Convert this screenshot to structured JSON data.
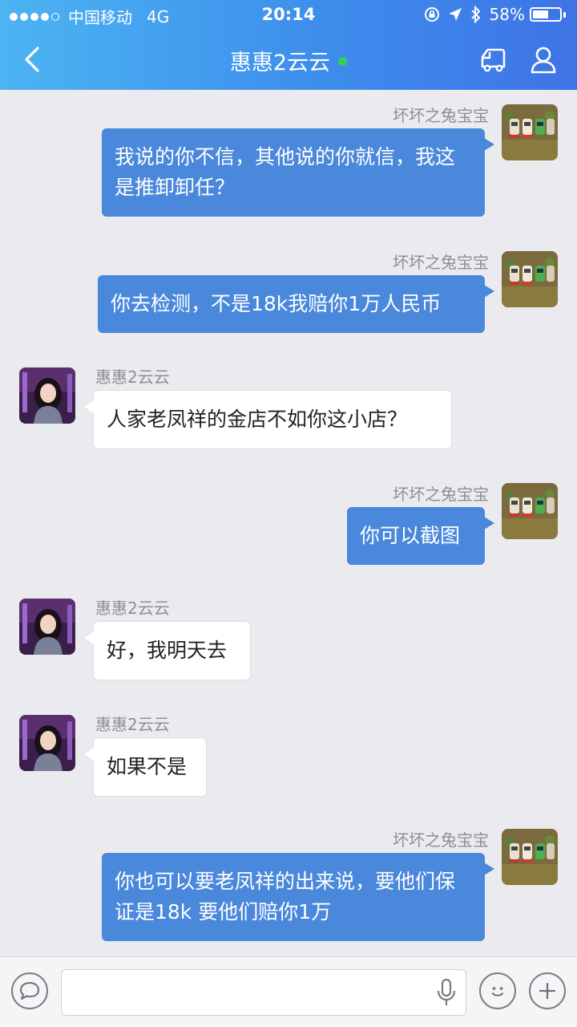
{
  "status_bar": {
    "carrier": "中国移动",
    "network": "4G",
    "time": "20:14",
    "battery_text": "58%",
    "battery_level": 0.58,
    "signal_strength": 4,
    "signal_max": 5
  },
  "nav": {
    "title": "惠惠2云云",
    "online_color": "#34d058",
    "back_icon": "chevron-left-icon",
    "shop_icon": "truck-icon",
    "profile_icon": "person-icon"
  },
  "messages": [
    {
      "direction": "out",
      "sender": "坏坏之兔宝宝",
      "text": "我说的你不信，其他说的你就信，我这是推卸卸任？"
    },
    {
      "direction": "out",
      "sender": "坏坏之兔宝宝",
      "text": "你去检测，不是18k我赔你1万人民币"
    },
    {
      "direction": "in",
      "sender": "惠惠2云云",
      "text": "人家老凤祥的金店不如你这小店？"
    },
    {
      "direction": "out",
      "sender": "坏坏之兔宝宝",
      "text": "你可以截图"
    },
    {
      "direction": "in",
      "sender": "惠惠2云云",
      "text": "好，我明天去"
    },
    {
      "direction": "in",
      "sender": "惠惠2云云",
      "text": "如果不是"
    },
    {
      "direction": "out",
      "sender": "坏坏之兔宝宝",
      "text": "你也可以要老凤祥的出来说，要他们保证是18k 要他们赔你1万"
    }
  ],
  "input_bar": {
    "value": "",
    "placeholder": "",
    "voice_icon": "speech-bubble-icon",
    "mic_icon": "microphone-icon",
    "emoji_icon": "smiley-icon",
    "more_icon": "plus-icon"
  },
  "colors": {
    "header_start": "#4cb4f2",
    "header_end": "#3f73e6",
    "outgoing_bubble": "#4a88dc",
    "incoming_bubble": "#ffffff",
    "background": "#ebebef"
  }
}
